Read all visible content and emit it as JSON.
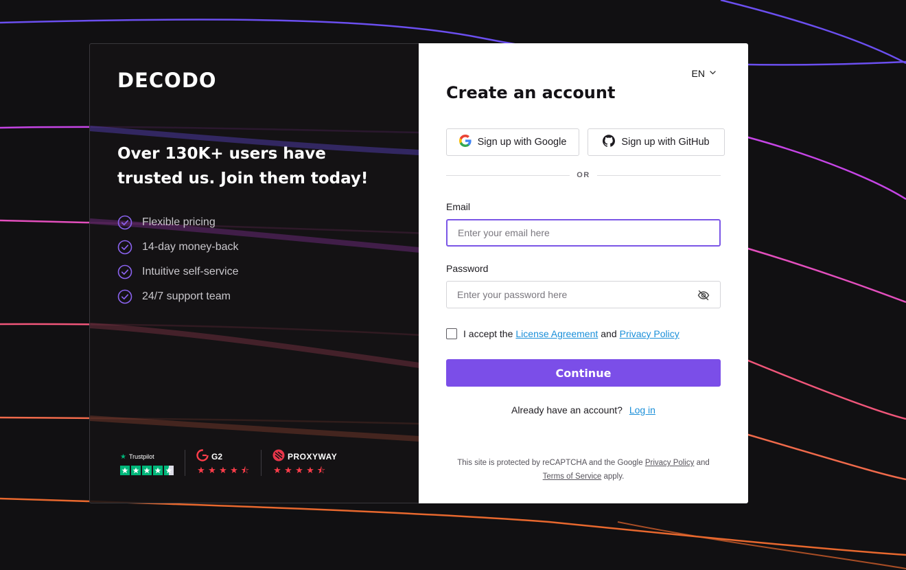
{
  "brand": {
    "logo_text": "DECODO",
    "accent": "#7b4ee8"
  },
  "promo": {
    "headline": "Over 130K+ users have trusted us. Join them today!",
    "features": [
      "Flexible pricing",
      "14-day money-back",
      "Intuitive self-service",
      "24/7 support team"
    ]
  },
  "ratings": {
    "trustpilot": {
      "label": "Trustpilot",
      "stars": 4.5,
      "color": "#00b67a"
    },
    "g2": {
      "label": "G2",
      "stars": 4.5,
      "color": "#ff3d4a"
    },
    "proxyway": {
      "label": "PROXYWAY",
      "stars": 4.5,
      "color": "#ff3d4a"
    }
  },
  "form": {
    "language": "EN",
    "title": "Create an account",
    "google_button": "Sign up with Google",
    "github_button": "Sign up with GitHub",
    "divider_text": "OR",
    "email_label": "Email",
    "email_placeholder": "Enter your email here",
    "password_label": "Password",
    "password_placeholder": "Enter your password here",
    "terms_prefix": "I accept the",
    "terms_link": "License Agreement",
    "terms_and": "and",
    "privacy_link": "Privacy Policy",
    "continue_button": "Continue",
    "login_prompt": "Already have an account?",
    "login_link": "Log in"
  },
  "recaptcha": {
    "text_1": "This site is protected by reCAPTCHA and the Google",
    "privacy_link": "Privacy Policy",
    "text_2": "and",
    "terms_link": "Terms of Service",
    "text_3": "apply."
  }
}
